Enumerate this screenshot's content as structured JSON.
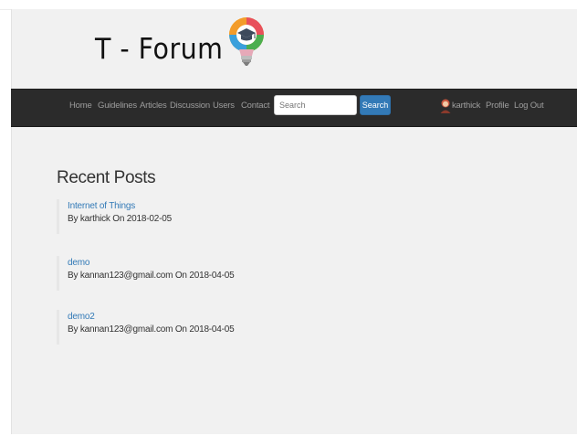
{
  "header": {
    "brand": "T - Forum",
    "logo_icon": "lightbulb-graduation-cap-logo"
  },
  "navbar": {
    "links": [
      {
        "label": "Home"
      },
      {
        "label": "Guidelines"
      },
      {
        "label": "Articles"
      },
      {
        "label": "Discussion"
      },
      {
        "label": "Users"
      },
      {
        "label": "Contact"
      }
    ],
    "search": {
      "placeholder": "Search",
      "button_label": "Search"
    },
    "user": {
      "avatar_icon": "user-avatar-icon",
      "name": "karthick"
    },
    "profile_label": "Profile",
    "logout_label": "Log Out",
    "background_color": "#2b2b2b",
    "accent_color": "#337ab7"
  },
  "main": {
    "section_title": "Recent Posts",
    "posts": [
      {
        "title": "Internet of Things",
        "meta": "By karthick On 2018-02-05"
      },
      {
        "title": "demo",
        "meta": "By kannan123@gmail.com On 2018-04-05"
      },
      {
        "title": "demo2",
        "meta": "By kannan123@gmail.com On 2018-04-05"
      }
    ]
  }
}
